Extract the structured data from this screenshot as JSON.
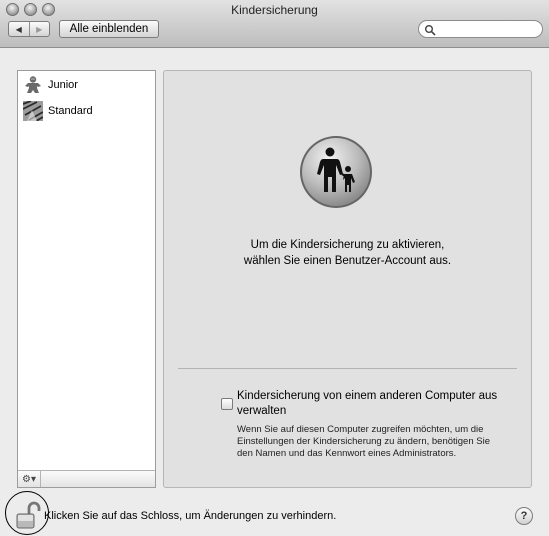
{
  "window": {
    "title": "Kindersicherung"
  },
  "toolbar": {
    "back_label": "◀",
    "forward_label": "▶",
    "show_all_label": "Alle einblenden",
    "search_placeholder": ""
  },
  "sidebar": {
    "users": [
      {
        "name": "Junior",
        "icon": "gingerbread-user-icon"
      },
      {
        "name": "Standard",
        "icon": "zebra-user-icon"
      }
    ],
    "gear_label": "⚙▾"
  },
  "main": {
    "message_line1": "Um die Kindersicherung zu aktivieren,",
    "message_line2": "wählen Sie einen Benutzer-Account aus.",
    "remote_label": "Kindersicherung von einem anderen Computer aus verwalten",
    "remote_checked": false,
    "remote_desc": "Wenn Sie auf diesen Computer zugreifen möchten, um die Einstellungen der Kindersicherung zu ändern, benötigen Sie den Namen und das Kennwort eines Administrators."
  },
  "footer": {
    "lock_text": "Klicken Sie auf das Schloss, um Änderungen zu verhindern.",
    "help_label": "?"
  }
}
